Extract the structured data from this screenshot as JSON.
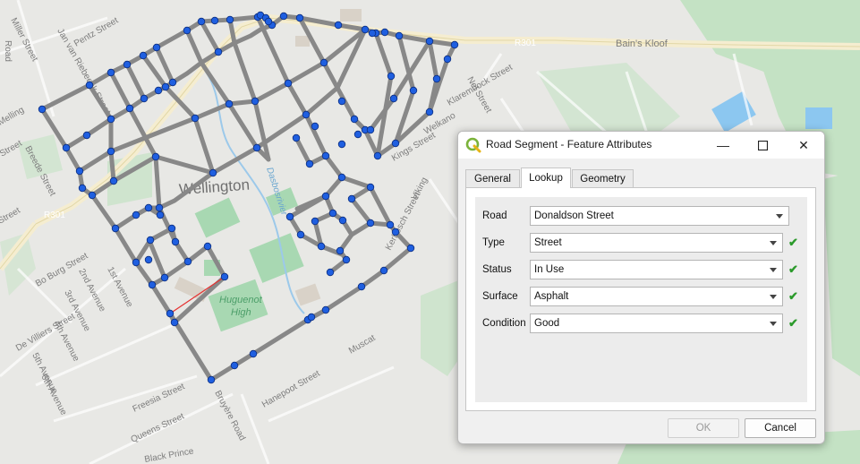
{
  "map": {
    "labels": {
      "town": "Wellington",
      "road_r301_east": "R301",
      "road_r301_west": "R301",
      "bains_kloof": "Bain's Kloof",
      "school": "Huguenot",
      "school_line2": "High",
      "river": "Dasbosrivier",
      "miller": "Miller Street",
      "jan_van_riebeeck": "Jan van Riebeeck Street",
      "pentz": "Pentz Street",
      "road_vertical": "Road",
      "melling": "Melling",
      "street_left1": "Street",
      "street_left2": "Street",
      "breede": "Breede Street",
      "bo_burg": "Bo Burg Street",
      "second_ave": "2nd Avenue",
      "first_ave": "1st Avenue",
      "third_ave": "3rd Avenue",
      "fourth_ave": "4th Avenue",
      "fifth_ave": "5th Avenue",
      "sixth_ave": "6th Avenue",
      "de_villiers": "De Villiers Street",
      "freesia": "Freesia Street",
      "queens": "Queens Street",
      "black_prince": "Black Prince",
      "bruyere": "Bruyère Road",
      "hanepoot": "Hanepoot Street",
      "muscat": "Muscat",
      "kerbosch": "Kerbosch Street",
      "klarembock": "Klarembock Street",
      "welkano": "Welkano",
      "kings": "Kings Street",
      "nel": "Nel Street",
      "viking": "Viking"
    },
    "colors": {
      "road": "#888888",
      "vertex": "#1f5fe0",
      "selected_segment": "#e53030",
      "park": "#bfe0c3",
      "water": "#8cc7f0"
    }
  },
  "dialog": {
    "title": "Road Segment - Feature Attributes",
    "app_icon": "qgis-icon",
    "tabs": [
      "General",
      "Lookup",
      "Geometry"
    ],
    "active_tab": "Lookup",
    "fields": [
      {
        "label": "Road",
        "value": "Donaldson Street",
        "valid": false
      },
      {
        "label": "Type",
        "value": "Street",
        "valid": true
      },
      {
        "label": "Status",
        "value": "In Use",
        "valid": true
      },
      {
        "label": "Surface",
        "value": "Asphalt",
        "valid": true
      },
      {
        "label": "Condition",
        "value": "Good",
        "valid": true
      }
    ],
    "ok_label": "OK",
    "cancel_label": "Cancel",
    "check_glyph": "✔",
    "minimize_glyph": "—",
    "maximize_glyph": "☐",
    "close_glyph": "✕"
  }
}
